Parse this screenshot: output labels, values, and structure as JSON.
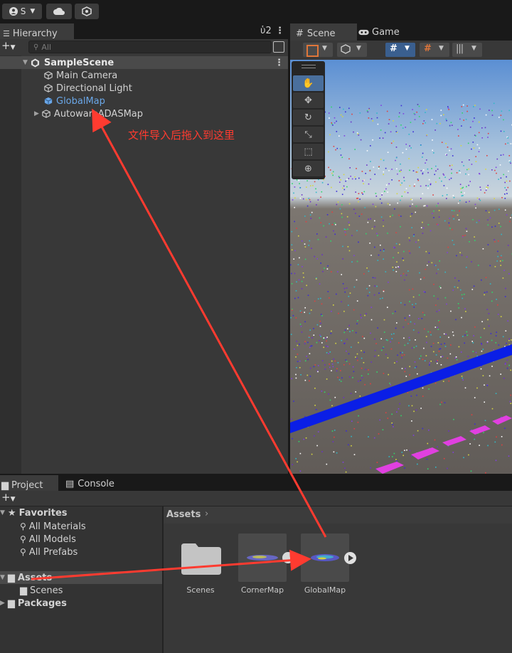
{
  "toolbar": {
    "account_label": "S",
    "account_icon": "account-icon",
    "cloud_icon": "cloud-icon",
    "collab_icon": "collab-icon"
  },
  "hierarchy": {
    "tab_label": "Hierarchy",
    "search_placeholder": "All",
    "scene_name": "SampleScene",
    "items": [
      {
        "label": "Main Camera"
      },
      {
        "label": "Directional Light"
      },
      {
        "label": "GlobalMap"
      },
      {
        "label": "AutowareADASMap"
      }
    ]
  },
  "scene": {
    "tab_scene": "Scene",
    "tab_game": "Game"
  },
  "annotation": {
    "text": "文件导入后拖入到这里",
    "color": "#ff3b30"
  },
  "project": {
    "tab_project": "Project",
    "tab_console": "Console",
    "favorites_label": "Favorites",
    "favorites": [
      "All Materials",
      "All Models",
      "All Prefabs"
    ],
    "assets_label": "Assets",
    "scenes_label": "Scenes",
    "packages_label": "Packages",
    "breadcrumb": "Assets",
    "asset_items": [
      "Scenes",
      "CornerMap",
      "GlobalMap"
    ]
  },
  "colors": {
    "accent": "#6aa7e8",
    "panel": "#383838",
    "selection": "#4a4a4a",
    "lane_blue": "#0a1ee6",
    "lane_pink": "#e040e0"
  }
}
